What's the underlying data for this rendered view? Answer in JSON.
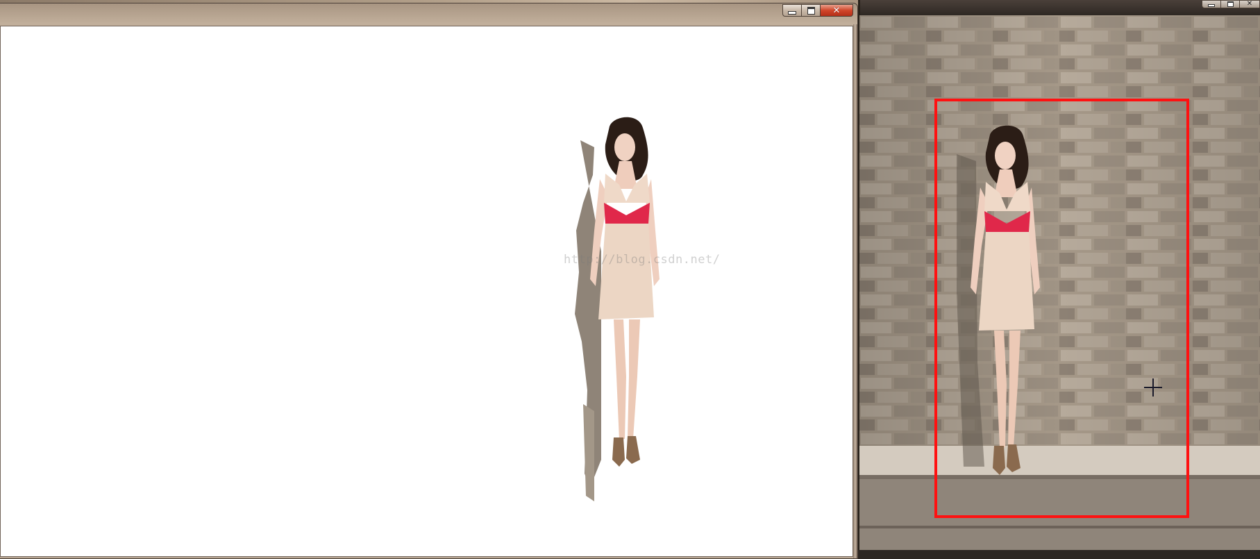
{
  "left_window": {
    "caption_buttons": {
      "minimize": "minimize",
      "maximize": "maximize",
      "close": "close"
    },
    "watermark": "http://blog.csdn.net/"
  },
  "right_window": {
    "caption_buttons": {
      "minimize": "minimize",
      "maximize": "maximize",
      "close": "close"
    }
  },
  "colors": {
    "selection_rect": "#ff1111",
    "dress": "#efd9c8",
    "sash": "#e0284a",
    "wall": "#a59888"
  },
  "icons": {
    "minimize": "minimize-icon",
    "maximize": "maximize-icon",
    "close": "close-icon",
    "crosshair": "crosshair-cursor-icon"
  }
}
